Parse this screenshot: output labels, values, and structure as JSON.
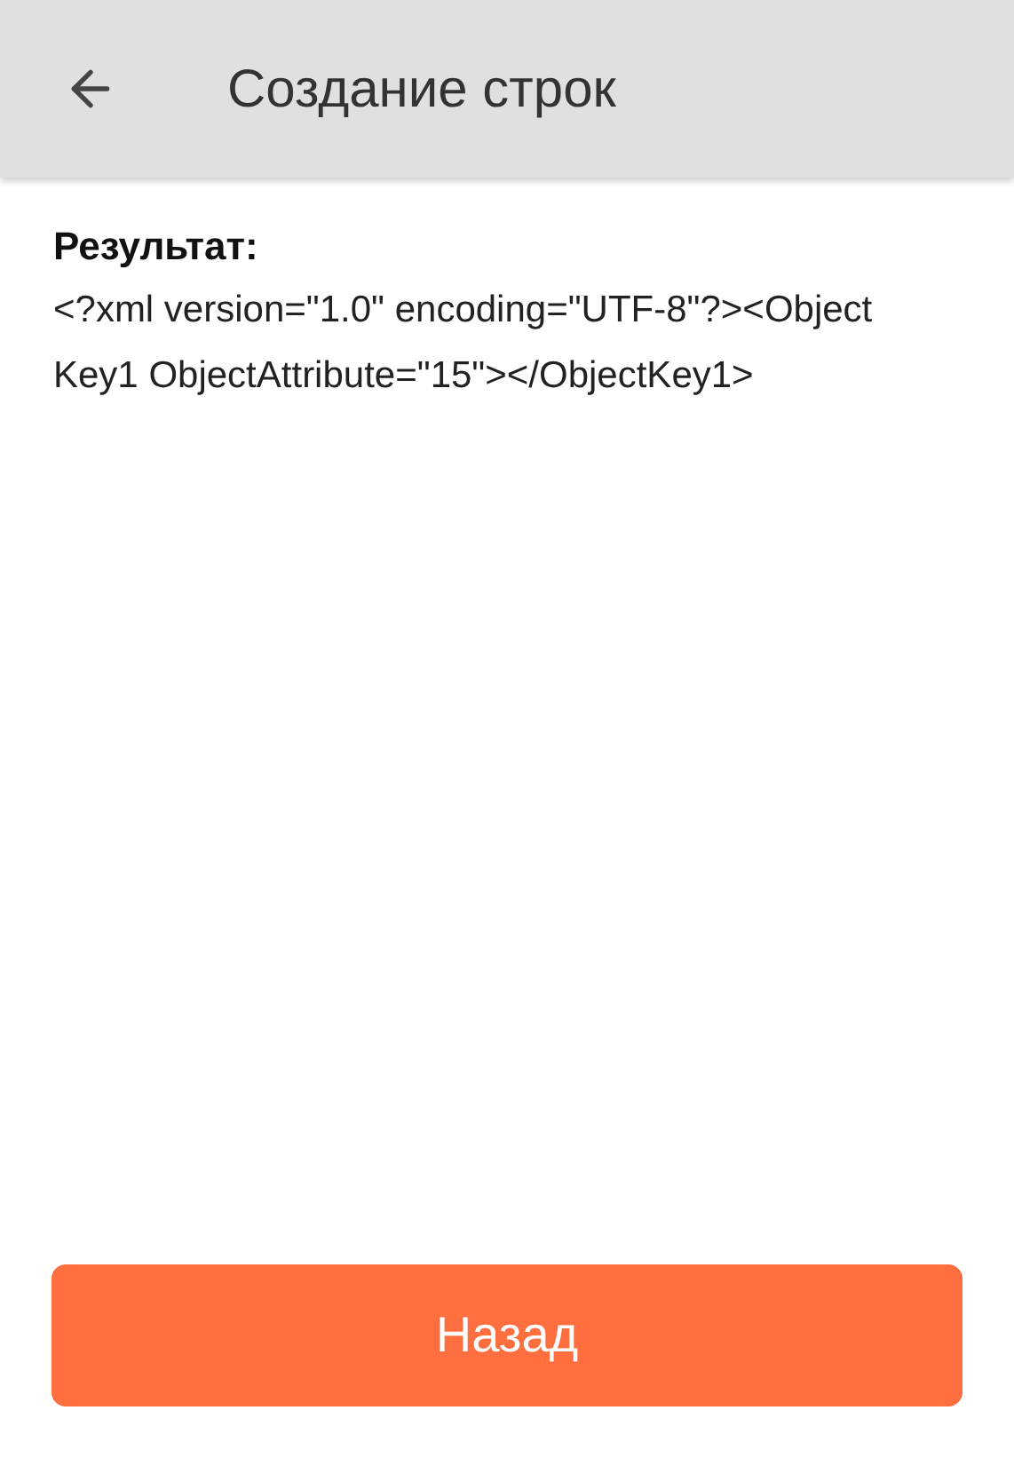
{
  "header": {
    "title": "Создание строк"
  },
  "result": {
    "label": "Результат:",
    "value": "<?xml version=\"1.0\" encoding=\"UTF-8\"?><ObjectKey1 ObjectAttribute=\"15\"></ObjectKey1>"
  },
  "buttons": [
    {
      "label": "Назад"
    }
  ]
}
